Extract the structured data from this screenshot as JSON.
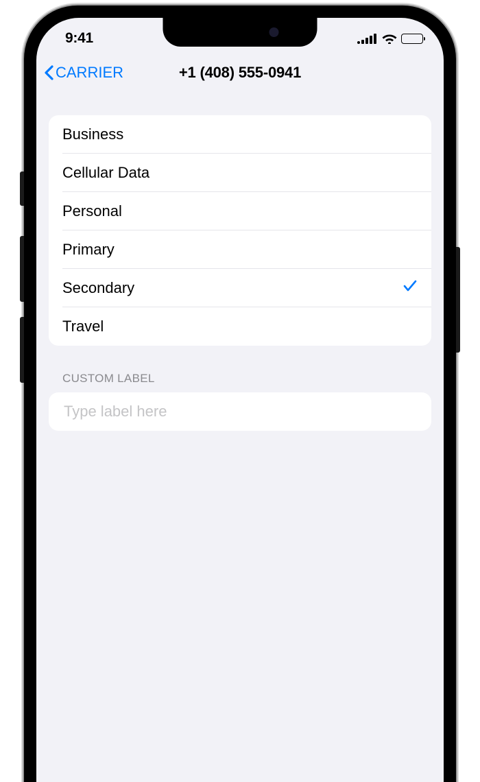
{
  "status": {
    "time": "9:41"
  },
  "nav": {
    "back_label": "CARRIER",
    "title": "+1 (408) 555-0941"
  },
  "labels": {
    "items": [
      {
        "label": "Business",
        "selected": false
      },
      {
        "label": "Cellular Data",
        "selected": false
      },
      {
        "label": "Personal",
        "selected": false
      },
      {
        "label": "Primary",
        "selected": false
      },
      {
        "label": "Secondary",
        "selected": true
      },
      {
        "label": "Travel",
        "selected": false
      }
    ]
  },
  "custom": {
    "header": "CUSTOM LABEL",
    "placeholder": "Type label here",
    "value": ""
  }
}
